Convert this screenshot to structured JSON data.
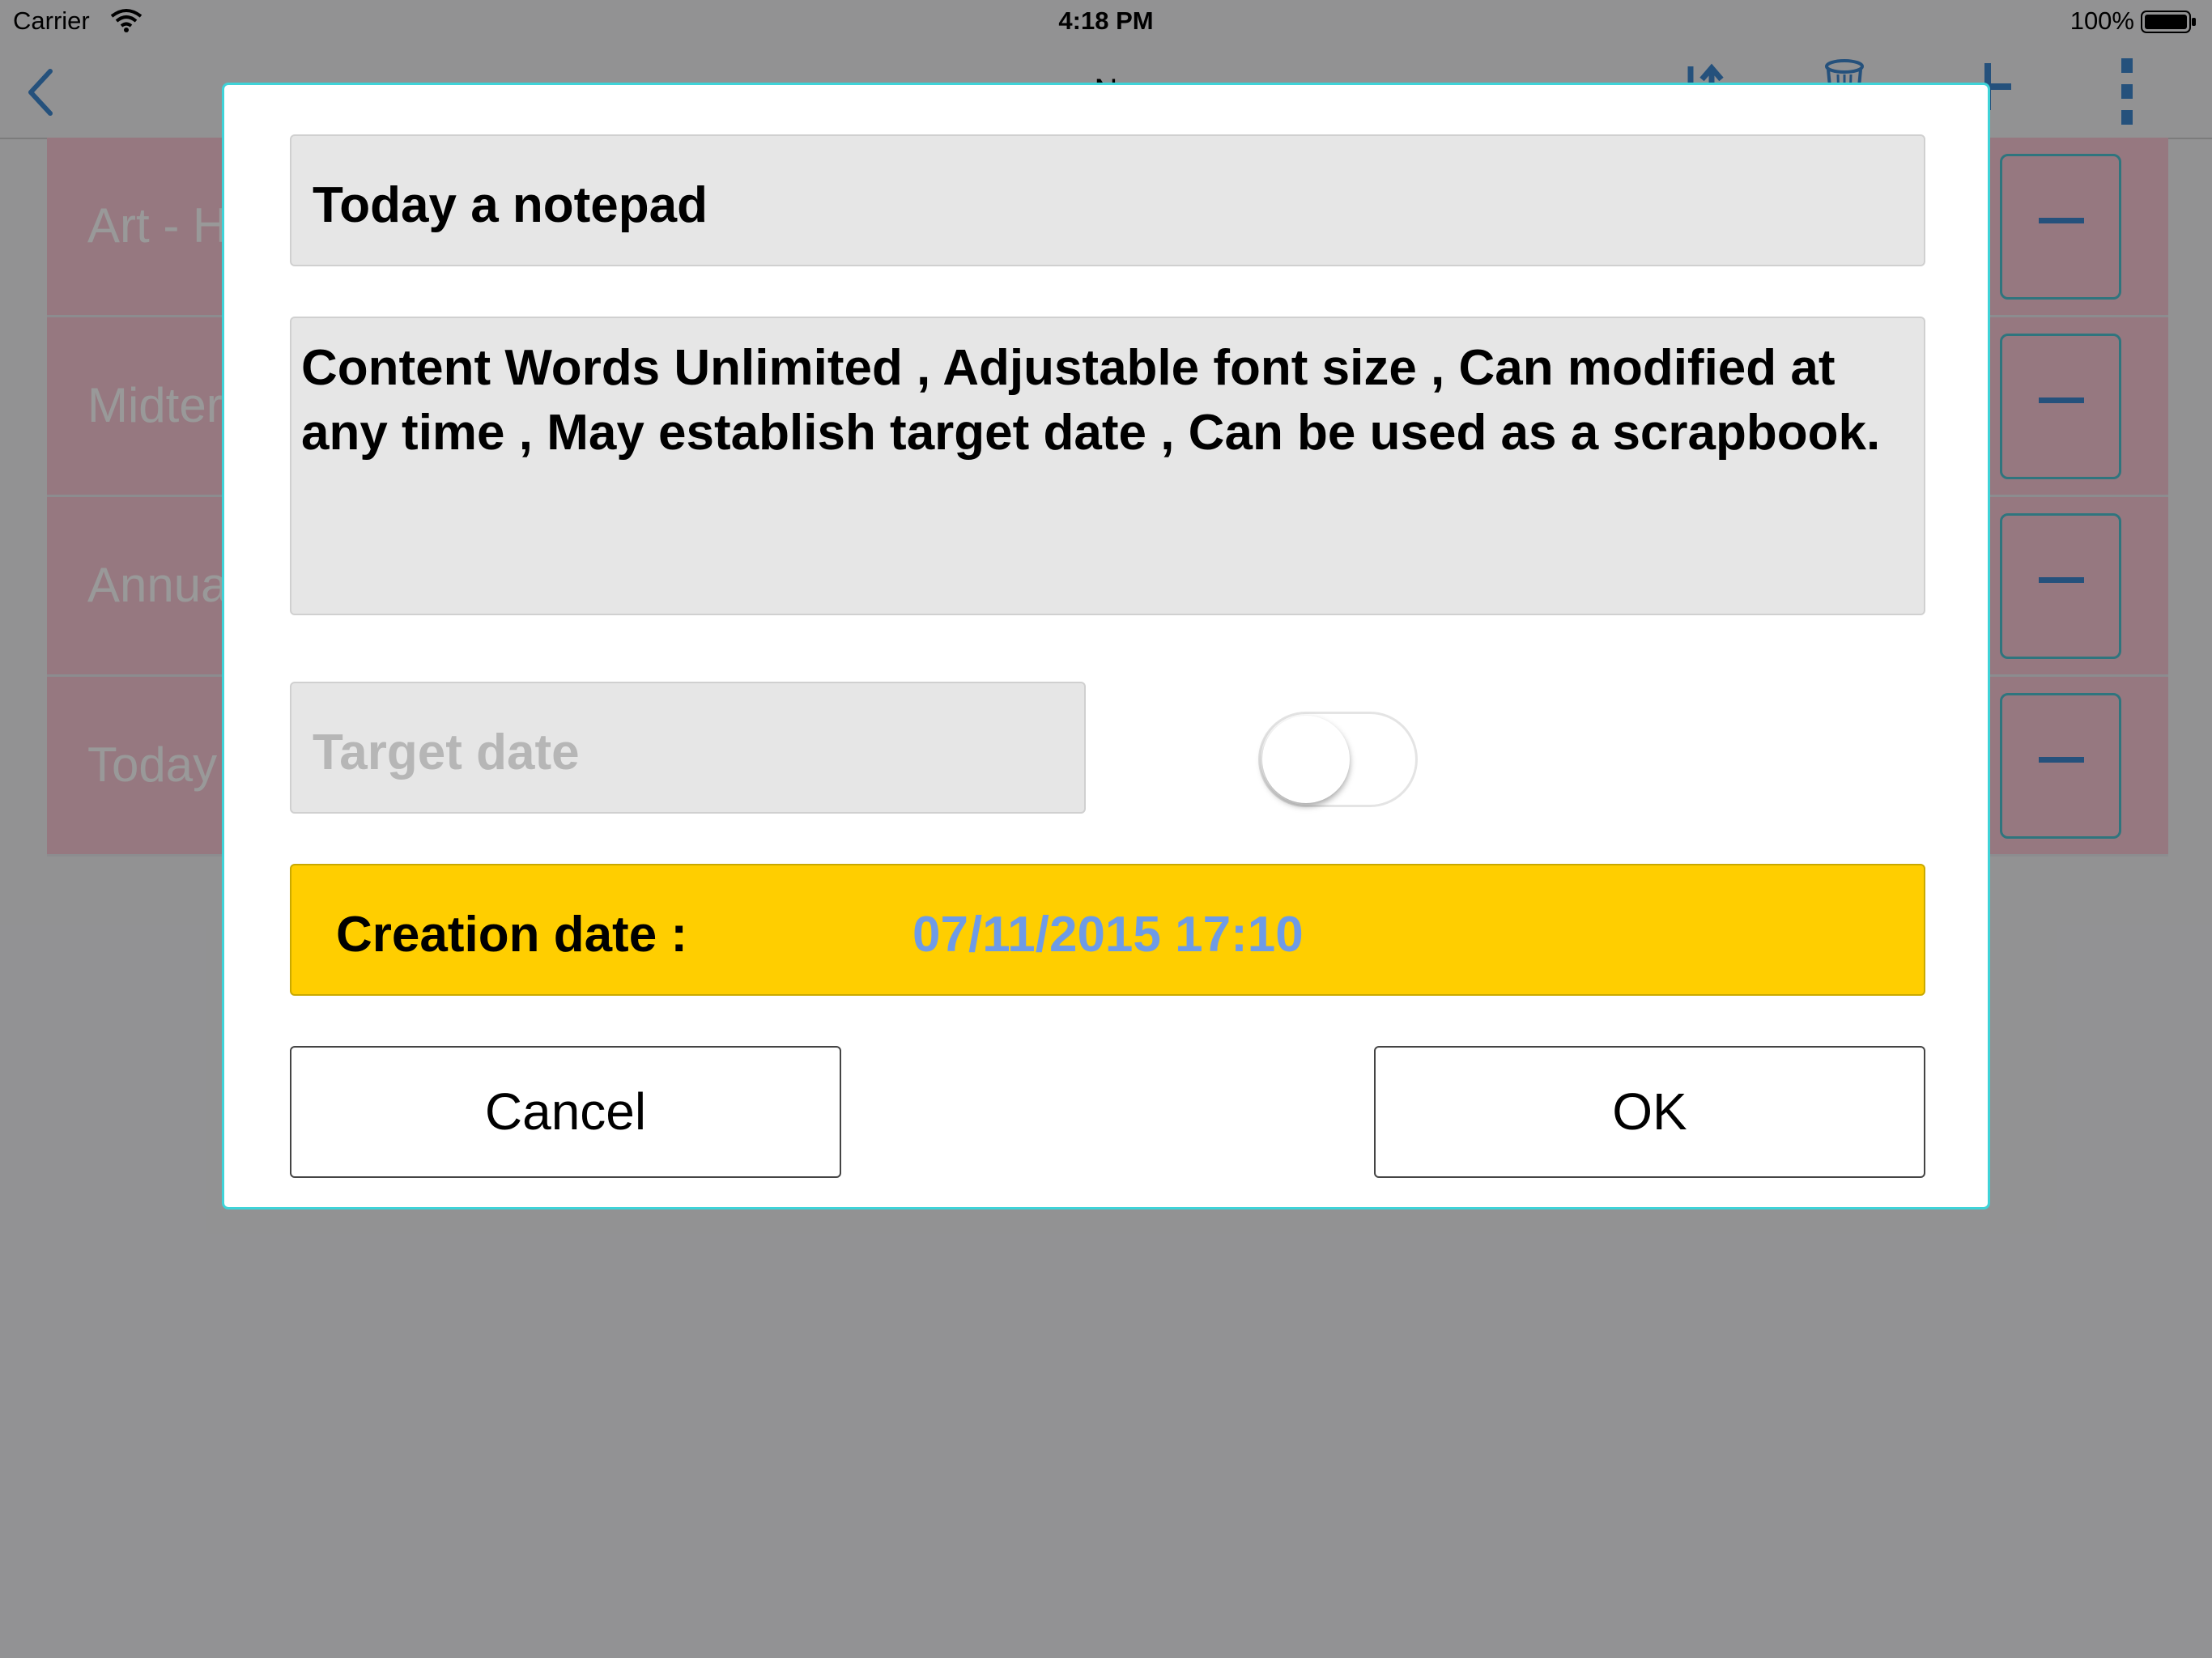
{
  "status_bar": {
    "carrier": "Carrier",
    "time": "4:18 PM",
    "battery": "100%"
  },
  "nav": {
    "title": "N"
  },
  "list": {
    "items": [
      {
        "title": "Art - H"
      },
      {
        "title": "Midter"
      },
      {
        "title": "Annua"
      },
      {
        "title": "Today"
      }
    ]
  },
  "dialog": {
    "title_value": "Today a notepad",
    "content_value": "Content Words Unlimited , Adjustable font size , Can modified at any time , May establish target date , Can be used as a scrapbook.",
    "target_placeholder": "Target date",
    "target_toggle_on": false,
    "creation_label": "Creation date :",
    "creation_value": "07/11/2015 17:10",
    "cancel_label": "Cancel",
    "ok_label": "OK"
  },
  "colors": {
    "accent": "#3f87cf",
    "dialog_border": "#3fd3d8",
    "creation_bar": "#ffce00",
    "creation_value": "#6e9be6",
    "list_item_bg": "#fbc9d6"
  },
  "icons": [
    "back-icon",
    "sort-icon",
    "trash-icon",
    "add-icon",
    "more-icon",
    "wifi-icon",
    "battery-icon"
  ]
}
